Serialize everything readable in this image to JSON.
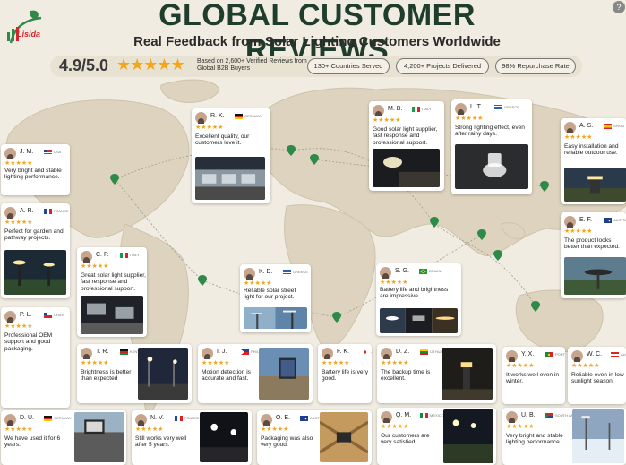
{
  "header": {
    "logo_text": "Lisida",
    "title": "GLOBAL CUSTOMER REVIEWS",
    "subtitle": "Real Feedback from Solar Lighting Customers Worldwide"
  },
  "stats": {
    "rating": "4.9/5.0",
    "stars": "★★★★★",
    "based_on": "Based on 2,600+ Verified Reviews from Global B2B Buyers",
    "pills": [
      "130+ Countries Served",
      "4,200+ Projects Delivered",
      "98% Repurchase Rate"
    ]
  },
  "colors": {
    "accent_green": "#1f3d2d",
    "star": "#f3a51c",
    "pin": "#2f8a4a",
    "background": "#f1ece2",
    "map": "#ddd3bf"
  },
  "reviews": [
    {
      "name": "J. M.",
      "country": "USA",
      "flag": "us",
      "stars": "★★★★★",
      "text": "Very bright and stable lighting performance."
    },
    {
      "name": "R. K.",
      "country": "GERMANY",
      "flag": "de",
      "stars": "★★★★★",
      "text": "Excellent quality, our customers love it.",
      "photo": "building"
    },
    {
      "name": "M. B.",
      "country": "ITALY",
      "flag": "it",
      "stars": "★★★★★",
      "text": "Good solar light supplier, fast response and professional support.",
      "photo": "wallnight"
    },
    {
      "name": "L. T.",
      "country": "GREECE",
      "flag": "gr",
      "stars": "★★★★★",
      "text": "Strong lighting effect, even after rainy days.",
      "photo": "walllamp"
    },
    {
      "name": "A. S.",
      "country": "SPAIN",
      "flag": "es",
      "stars": "★★★★★",
      "text": "Easy installation and reliable outdoor use.",
      "photo": "bollard"
    },
    {
      "name": "A. R.",
      "country": "FRANCE",
      "flag": "fr",
      "stars": "★★★★★",
      "text": "Perfect for garden and pathway projects.",
      "photo": "garden"
    },
    {
      "name": "E. F.",
      "country": "AUSTRALIA",
      "flag": "au",
      "stars": "★★★★★",
      "text": "The product looks better than expected.",
      "photo": "ufo"
    },
    {
      "name": "C. P.",
      "country": "ITALY",
      "flag": "it",
      "stars": "★★★★★",
      "text": "Great solar light supplier, fast response and professional support.",
      "photo": "floods"
    },
    {
      "name": "K. D.",
      "country": "GREECE",
      "flag": "gr",
      "stars": "★★★★★",
      "text": "Reliable solar street light for our project.",
      "photo": "street"
    },
    {
      "name": "S. G.",
      "country": "BRAZIL",
      "flag": "br",
      "stars": "★★★★★",
      "text": "Battery life and brightness are impressive.",
      "photo": "threeup"
    },
    {
      "name": "P. L.",
      "country": "CHILE",
      "flag": "cl",
      "stars": "★★★★★",
      "text": "Professional OEM support and good packaging."
    },
    {
      "name": "T. R.",
      "country": "KENYA",
      "flag": "ke",
      "stars": "★★★★★",
      "text": "Brightness is better than expected",
      "photo": "road"
    },
    {
      "name": "I. J.",
      "country": "PHILIPPINES",
      "flag": "ph",
      "stars": "★★★★★",
      "text": "Motion detection is accurate and fast.",
      "photo": "sensor"
    },
    {
      "name": "F. K.",
      "country": "JAPAN",
      "flag": "jp",
      "stars": "★★★★★",
      "text": "Battery life is very good."
    },
    {
      "name": "D. Z.",
      "country": "LITHUANIA",
      "flag": "lt",
      "stars": "★★★★★",
      "text": "The backup time is excellent.",
      "photo": "bollardnight"
    },
    {
      "name": "Y. X.",
      "country": "PORTUGAL",
      "flag": "pt",
      "stars": "★★★★★",
      "text": "It works well even in winter."
    },
    {
      "name": "W. C.",
      "country": "AUSTRIA",
      "flag": "at",
      "stars": "★★★★★",
      "text": "Reliable even in low sunlight season."
    },
    {
      "name": "D. U.",
      "country": "GERMANY",
      "flag": "de",
      "stars": "★★★★★",
      "text": "We have used it for 6 years.",
      "photo": "flood2"
    },
    {
      "name": "N. V.",
      "country": "FRANCE",
      "flag": "fr",
      "stars": "★★★★★",
      "text": "Still works very well after 5 years.",
      "photo": "night"
    },
    {
      "name": "O. E.",
      "country": "AUSTRALIA",
      "flag": "au",
      "stars": "★★★★★",
      "text": "Packaging was also very good.",
      "photo": "crate"
    },
    {
      "name": "Q. M.",
      "country": "MEXICO",
      "flag": "mx",
      "stars": "★★★★★",
      "text": "Our customers are very satisfied.",
      "photo": "park"
    },
    {
      "name": "U. B.",
      "country": "SOUTH AFRICA",
      "flag": "za",
      "stars": "★★★★★",
      "text": "Very bright and stable lighting performance.",
      "photo": "snow"
    }
  ]
}
